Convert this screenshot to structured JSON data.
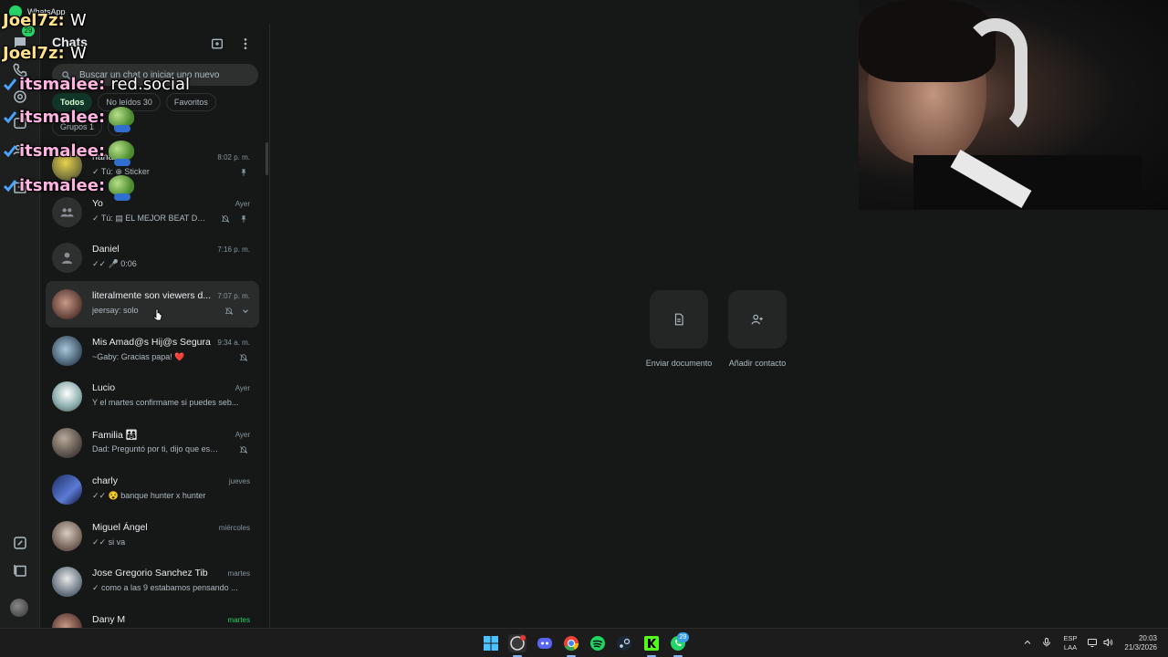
{
  "window": {
    "app_title": "WhatsApp"
  },
  "rail": {
    "chats_badge": "29"
  },
  "panel": {
    "title": "Chats",
    "search_placeholder": "Buscar un chat o iniciar uno nuevo",
    "filters": [
      {
        "label": "Todos",
        "active": true
      },
      {
        "label": "No leídos 30",
        "active": false
      },
      {
        "label": "Favoritos",
        "active": false
      }
    ],
    "groups_chip": "Grupos 1",
    "add_chip": "+"
  },
  "chats": [
    {
      "name": "nana fr",
      "time": "8:02 p. m.",
      "preview": "✓ Tú: ⊕ Sticker",
      "pinned": true,
      "muted": false
    },
    {
      "name": "Yo",
      "time": "Ayer",
      "preview": "✓ Tú: ▤ EL MEJOR BEAT DE ...",
      "pinned": true,
      "muted": true
    },
    {
      "name": "Daniel",
      "time": "7:16 p. m.",
      "preview": "✓✓ 🎤 0:06",
      "pinned": false,
      "muted": false
    },
    {
      "name": "literalmente son viewers d...",
      "time": "7:07 p. m.",
      "preview": "jeersay: solo",
      "pinned": false,
      "muted": true
    },
    {
      "name": "Mis Amad@s Hij@s Segura",
      "time": "9:34 a. m.",
      "preview": "~Gaby: Gracias papa! ❤️",
      "pinned": false,
      "muted": true
    },
    {
      "name": "Lucio",
      "time": "Ayer",
      "preview": "Y el martes confirmame si puedes seb...",
      "pinned": false,
      "muted": false
    },
    {
      "name": "Familia 👨‍👩‍👧",
      "time": "Ayer",
      "preview": "Dad: Preguntó por ti, dijo que estab...",
      "pinned": false,
      "muted": true
    },
    {
      "name": "charly",
      "time": "jueves",
      "preview": "✓✓ 😵 banque hunter x hunter",
      "pinned": false,
      "muted": false
    },
    {
      "name": "Miguel Ángel",
      "time": "miércoles",
      "preview": "✓✓ si va",
      "pinned": false,
      "muted": false
    },
    {
      "name": "Jose Gregorio Sanchez Tib",
      "time": "martes",
      "preview": "✓ como a las 9 estabamos pensando ...",
      "pinned": false,
      "muted": false
    },
    {
      "name": "Dany M",
      "time": "martes",
      "preview": "",
      "pinned": false,
      "muted": false
    }
  ],
  "main": {
    "send_document": "Enviar documento",
    "add_contact": "Añadir contacto"
  },
  "stream_chat": [
    {
      "user": "Joel7z:",
      "message": "W"
    },
    {
      "user": "Joel7z:",
      "message": "W"
    },
    {
      "user": "itsmalee:",
      "message": "red.social"
    },
    {
      "user": "itsmalee:",
      "message": ""
    },
    {
      "user": "itsmalee:",
      "message": ""
    },
    {
      "user": "itsmalee:",
      "message": ""
    }
  ],
  "taskbar": {
    "whatsapp_badge": "29",
    "lang_top": "ESP",
    "lang_bottom": "LAA",
    "time": "20:03",
    "date": "21/3/2026"
  },
  "colors": {
    "accent": "#25d366",
    "background": "#161717",
    "panel": "#1d1f1f",
    "chip_active": "#103529"
  }
}
